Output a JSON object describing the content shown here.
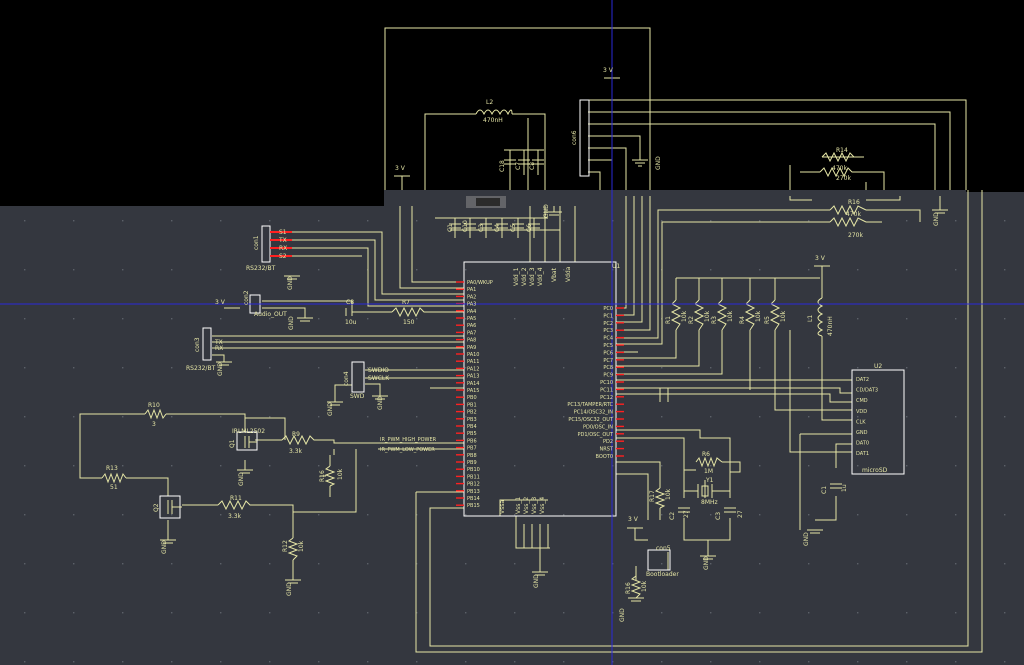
{
  "colors": {
    "canvas": "#34373f",
    "unrendered": "#000000",
    "wire": "#e6e6a6",
    "body": "#ffffff",
    "pin": "#ff2020",
    "grid_dot": "#5c6068",
    "cursor": "#2a2ad8"
  },
  "supply_label": "3 V",
  "gnd_label": "GND",
  "u1": {
    "ref": "U1",
    "left_pins": [
      "PA0/WKUP",
      "PA1",
      "PA2",
      "PA3",
      "PA4",
      "PA5",
      "PA6",
      "PA7",
      "PA8",
      "PA9",
      "PA10",
      "PA11",
      "PA12",
      "PA13",
      "PA14",
      "PA15",
      "PB0",
      "PB1",
      "PB2",
      "PB3",
      "PB4",
      "PB5",
      "PB6",
      "PB7",
      "PB8",
      "PB9",
      "PB10",
      "PB11",
      "PB12",
      "PB13",
      "PB14",
      "PB15"
    ],
    "right_pins": [
      "PC0",
      "PC1",
      "PC2",
      "PC3",
      "PC4",
      "PC5",
      "PC6",
      "PC7",
      "PC8",
      "PC9",
      "PC10",
      "PC11",
      "PC12",
      "PC13/TAMPER/RTC",
      "PC14/OSC32_IN",
      "PC15/OSC32_OUT",
      "PD0/OSC_IN",
      "PD1/OSC_OUT",
      "PD2",
      "NRST",
      "BOOT0"
    ],
    "top_pins": [
      "Vdd_1",
      "Vdd_2",
      "Vdd_3",
      "Vdd_4",
      "Vbat",
      "Vdda"
    ],
    "bottom_pins": [
      "Vssa",
      "Vss_1",
      "Vss_2",
      "Vss_3",
      "Vss_4"
    ]
  },
  "u2": {
    "ref": "U2",
    "name": "microSD",
    "pins": [
      "DAT2",
      "CD/DAT3",
      "CMD",
      "VDD",
      "CLK",
      "GND",
      "DAT0",
      "DAT1"
    ]
  },
  "connectors": {
    "con1": {
      "ref": "con1",
      "value": "RS232/BT",
      "pins": [
        "S1",
        "TX",
        "RX",
        "S2"
      ]
    },
    "con2": {
      "ref": "con2",
      "value": "Audio_OUT"
    },
    "con3": {
      "ref": "con3",
      "value": "RS232/BT",
      "pins": [
        "TX",
        "RX"
      ]
    },
    "con4": {
      "ref": "con4",
      "value": "SWD",
      "pins": [
        "SWDIO",
        "SWCLK"
      ]
    },
    "con5": {
      "ref": "con5",
      "value": "Bootloader"
    },
    "con6": {
      "ref": "con6"
    }
  },
  "resistors": {
    "r1": {
      "ref": "R1",
      "value": "10k"
    },
    "r2": {
      "ref": "R2",
      "value": "10k"
    },
    "r3": {
      "ref": "R3",
      "value": "10k"
    },
    "r4": {
      "ref": "R4",
      "value": "10k"
    },
    "r5": {
      "ref": "R5",
      "value": "10k"
    },
    "r6": {
      "ref": "R6",
      "value": "1M"
    },
    "r7": {
      "ref": "R7",
      "value": "150"
    },
    "r9": {
      "ref": "R9",
      "value": "3.3k"
    },
    "r10": {
      "ref": "R10",
      "value": "3"
    },
    "r11": {
      "ref": "R11",
      "value": "3.3k"
    },
    "r12": {
      "ref": "R12",
      "value": "10k"
    },
    "r13": {
      "ref": "R13",
      "value": "51"
    },
    "r14": {
      "ref": "R14",
      "value": "470k"
    },
    "r15": {
      "ref": "R15",
      "value": "270k"
    },
    "r16": {
      "ref": "R16",
      "value": "470k"
    },
    "r17": {
      "ref": "R17",
      "value": "10k"
    },
    "rpot": {
      "ref": "R16",
      "value": "10k"
    },
    "rq": {
      "ref": "R",
      "value": "10k"
    },
    "rb": {
      "ref": "",
      "value": "270k"
    }
  },
  "capacitors": {
    "c8": {
      "ref": "C8",
      "value": "10u"
    },
    "c2": {
      "ref": "C2",
      "value": "27"
    },
    "c3": {
      "ref": "C3",
      "value": "27"
    },
    "c1": {
      "ref": "C1",
      "value": "1u"
    },
    "top": [
      "C1",
      "C10",
      "C3",
      "C4",
      "C5",
      "C6"
    ],
    "upper": [
      "C18",
      "C7",
      "C8"
    ]
  },
  "inductors": {
    "l2": {
      "ref": "L2",
      "value": "470nH"
    },
    "l1": {
      "ref": "L1",
      "value": "470nH"
    }
  },
  "crystal": {
    "ref": "Y1",
    "value": "8MHz"
  },
  "transistors": {
    "q1": {
      "ref": "Q1",
      "value": "IRLML2502"
    },
    "q2": {
      "ref": "Q2"
    }
  },
  "nets": {
    "pwm_high": "IR_PWM_HIGH_POWER",
    "pwm_low": "IR_PWM_LOW_POWER",
    "pb12": "PB12"
  }
}
